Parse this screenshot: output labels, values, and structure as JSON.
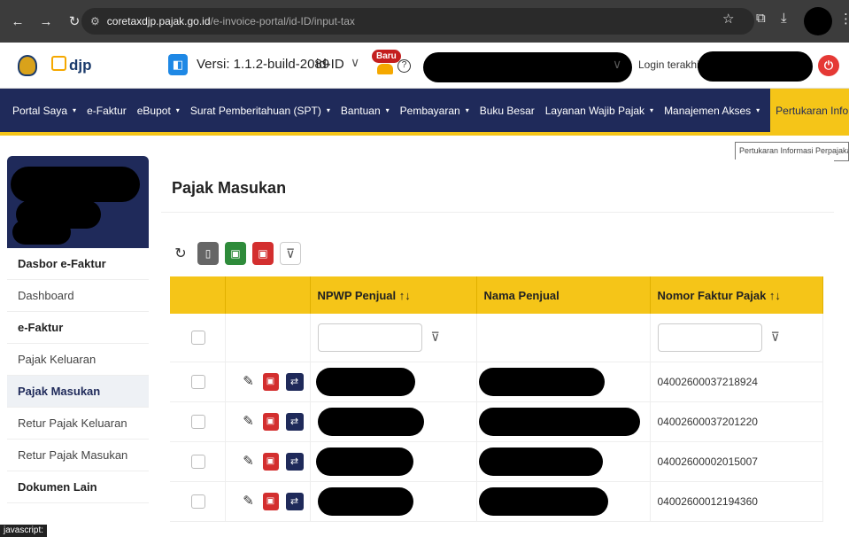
{
  "browser": {
    "url_domain": "coretaxdjp.pajak.go.id",
    "url_path": "/e-invoice-portal/id-ID/input-tax"
  },
  "header": {
    "logo_text": "djp",
    "version_text": "Versi: 1.1.2-build-2089",
    "language": "id-ID",
    "baru_badge": "Baru",
    "login_label": "Login terakhir"
  },
  "nav": {
    "items": [
      {
        "label": "Portal Saya",
        "caret": "▾"
      },
      {
        "label": "e-Faktur",
        "caret": ""
      },
      {
        "label": "eBupot",
        "caret": "▾"
      },
      {
        "label": "Surat Pemberitahuan (SPT)",
        "caret": "▾"
      },
      {
        "label": "Bantuan",
        "caret": "▾"
      },
      {
        "label": "Pembayaran",
        "caret": "▾"
      },
      {
        "label": "Buku Besar",
        "caret": ""
      },
      {
        "label": "Layanan Wajib Pajak",
        "caret": "▾"
      },
      {
        "label": "Manajemen Akses",
        "caret": "▾"
      },
      {
        "label": "Pertukaran Informasi Perpajakan",
        "caret": ""
      }
    ],
    "tooltip": "Pertukaran Informasi Perpajakan"
  },
  "sidebar": {
    "items": [
      {
        "label": "Dasbor e-Faktur",
        "kind": "heading"
      },
      {
        "label": "Dashboard",
        "kind": "item"
      },
      {
        "label": "e-Faktur",
        "kind": "heading"
      },
      {
        "label": "Pajak Keluaran",
        "kind": "item"
      },
      {
        "label": "Pajak Masukan",
        "kind": "active"
      },
      {
        "label": "Retur Pajak Keluaran",
        "kind": "item"
      },
      {
        "label": "Retur Pajak Masukan",
        "kind": "item"
      },
      {
        "label": "Dokumen Lain",
        "kind": "heading"
      }
    ]
  },
  "status_bar": "javascript:",
  "main": {
    "title": "Pajak Masukan",
    "columns": [
      "",
      "",
      "NPWP Penjual ↑↓",
      "Nama Penjual",
      "Nomor Faktur Pajak ↑↓"
    ],
    "rows": [
      {
        "nomor_faktur": "04002600037218924"
      },
      {
        "nomor_faktur": "04002600037201220"
      },
      {
        "nomor_faktur": "04002600002015007"
      },
      {
        "nomor_faktur": "04002600012194360"
      }
    ]
  }
}
